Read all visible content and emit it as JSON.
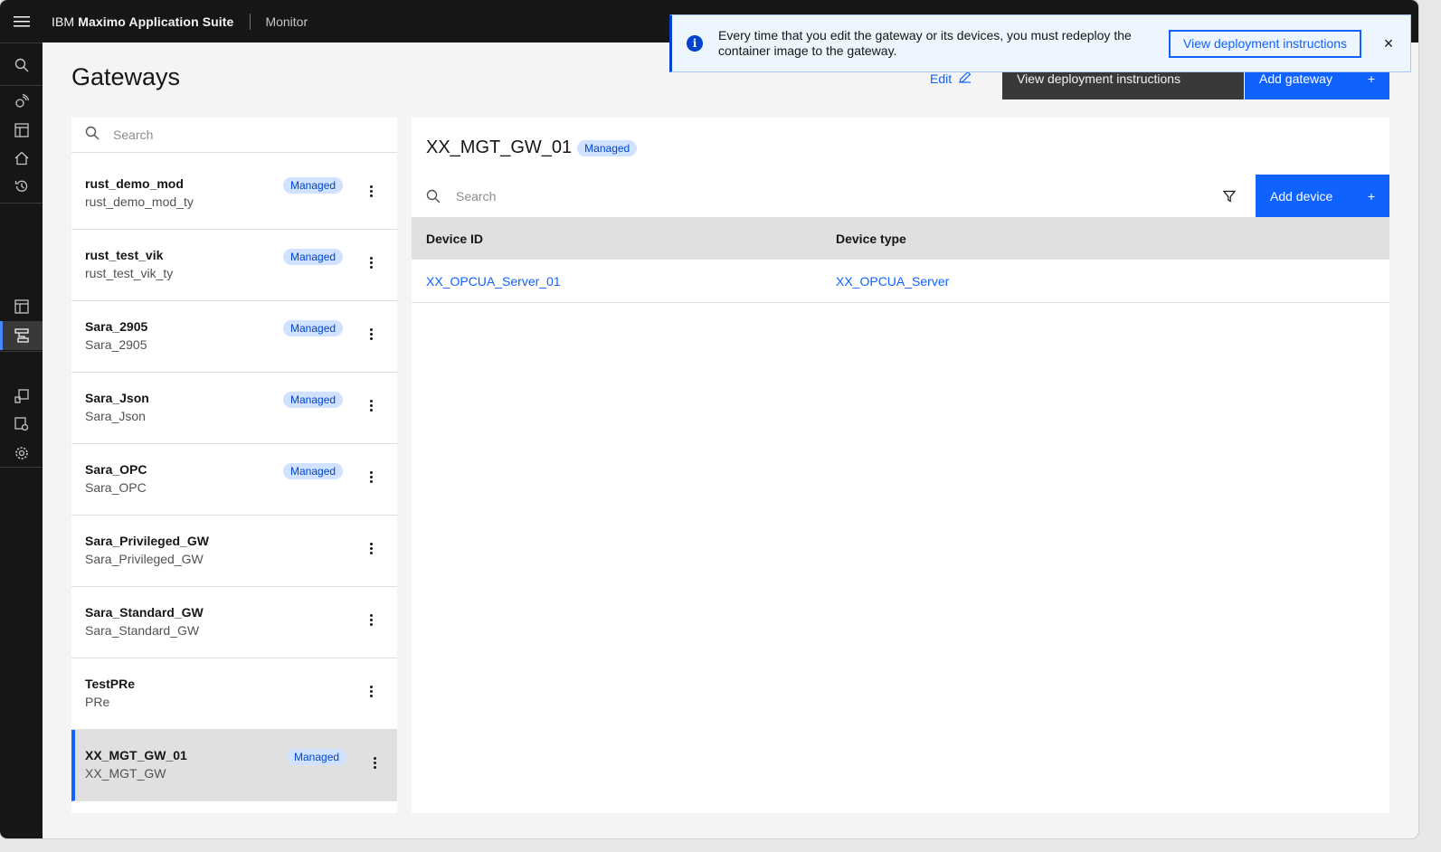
{
  "header": {
    "brand_prefix": "IBM",
    "brand_name": "Maximo Application Suite",
    "app_name": "Monitor"
  },
  "page": {
    "title": "Gateways",
    "edit_label": "Edit",
    "view_deployment_label": "View deployment instructions",
    "add_gateway_label": "Add gateway"
  },
  "notification": {
    "message": "Every time that you edit the gateway or its devices, you must redeploy the container image to the gateway.",
    "action_label": "View deployment instructions",
    "close_symbol": "×"
  },
  "gateway_list": {
    "search_placeholder": "Search",
    "items": [
      {
        "name": "rust_demo_mod",
        "type": "rust_demo_mod_ty",
        "tag": "Managed"
      },
      {
        "name": "rust_test_vik",
        "type": "rust_test_vik_ty",
        "tag": "Managed"
      },
      {
        "name": "Sara_2905",
        "type": "Sara_2905",
        "tag": "Managed"
      },
      {
        "name": "Sara_Json",
        "type": "Sara_Json",
        "tag": "Managed"
      },
      {
        "name": "Sara_OPC",
        "type": "Sara_OPC",
        "tag": "Managed"
      },
      {
        "name": "Sara_Privileged_GW",
        "type": "Sara_Privileged_GW",
        "tag": ""
      },
      {
        "name": "Sara_Standard_GW",
        "type": "Sara_Standard_GW",
        "tag": ""
      },
      {
        "name": "TestPRe",
        "type": "PRe",
        "tag": ""
      },
      {
        "name": "XX_MGT_GW_01",
        "type": "XX_MGT_GW",
        "tag": "Managed",
        "selected": true
      }
    ]
  },
  "detail": {
    "title": "XX_MGT_GW_01",
    "tag": "Managed",
    "search_placeholder": "Search",
    "add_device_label": "Add device",
    "columns": [
      "Device ID",
      "Device type"
    ],
    "rows": [
      {
        "device_id": "XX_OPCUA_Server_01",
        "device_type": "XX_OPCUA_Server"
      }
    ]
  },
  "icons": {
    "plus": "+",
    "accent": "#0f62fe"
  }
}
